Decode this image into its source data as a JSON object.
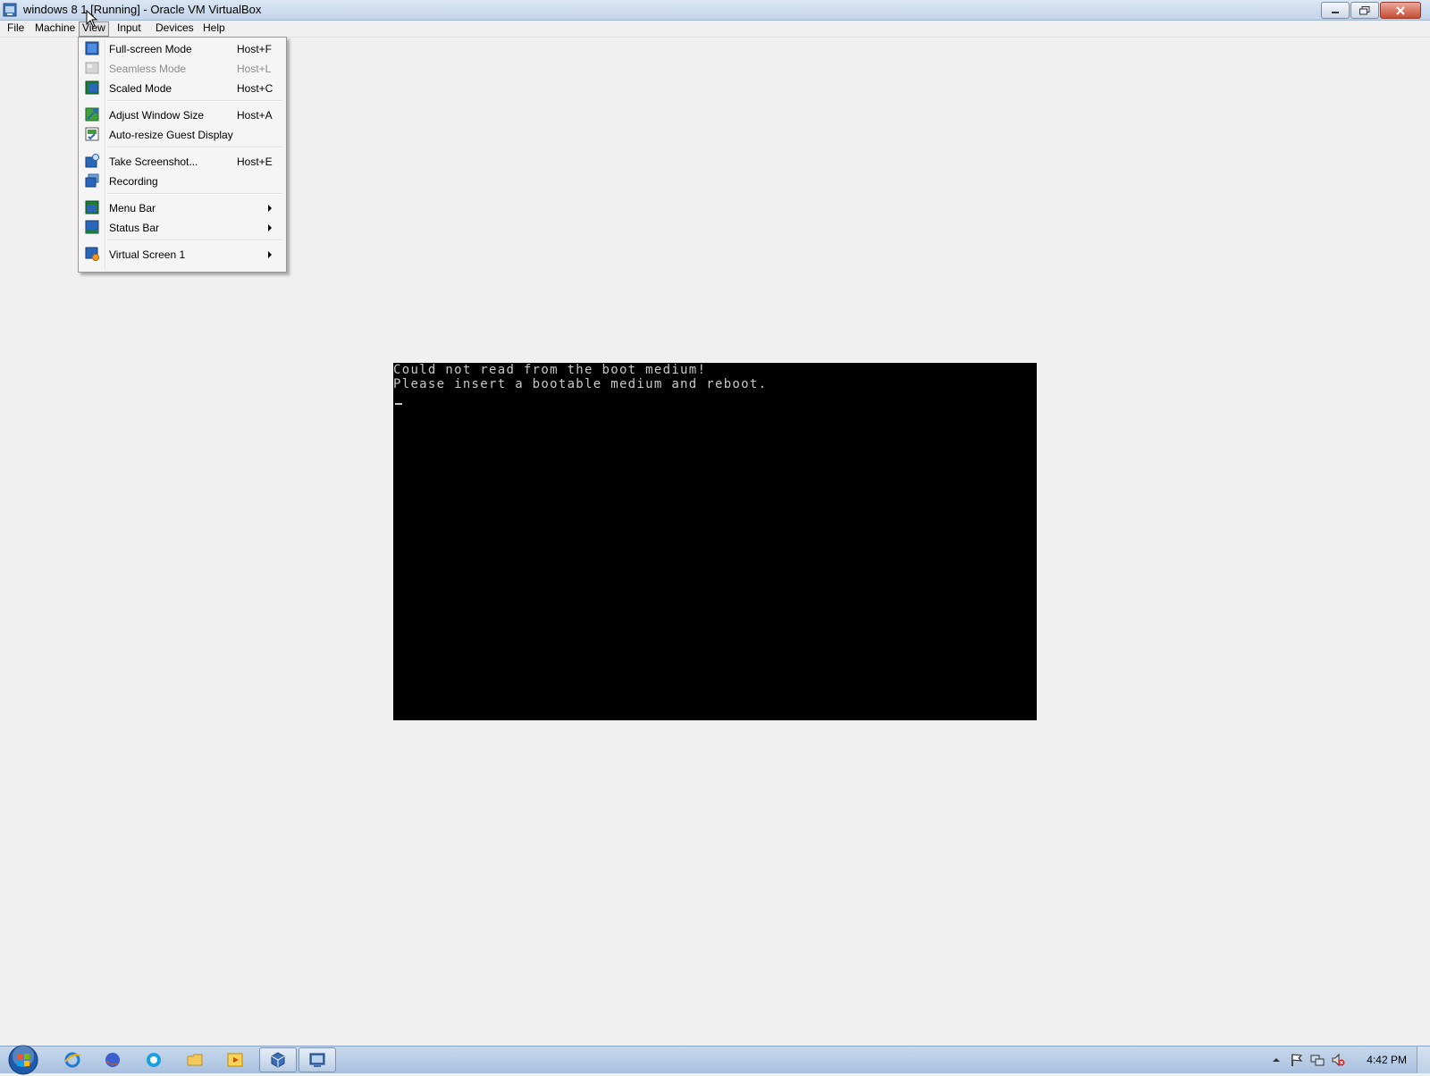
{
  "window": {
    "title": "windows 8 1 [Running] - Oracle VM VirtualBox"
  },
  "menubar": {
    "items": [
      {
        "label": "File"
      },
      {
        "label": "Machine"
      },
      {
        "label": "View"
      },
      {
        "label": "Input"
      },
      {
        "label": "Devices"
      },
      {
        "label": "Help"
      }
    ],
    "active": "View"
  },
  "view_menu": {
    "items": [
      {
        "label": "Full-screen Mode",
        "shortcut": "Host+F",
        "icon": "fullscreen-icon"
      },
      {
        "label": "Seamless Mode",
        "shortcut": "Host+L",
        "icon": "seamless-icon",
        "disabled": true
      },
      {
        "label": "Scaled Mode",
        "shortcut": "Host+C",
        "icon": "scaled-icon"
      },
      {
        "label": "Adjust Window Size",
        "shortcut": "Host+A",
        "icon": "adjust-window-icon"
      },
      {
        "label": "Auto-resize Guest Display",
        "shortcut": "",
        "icon": "auto-resize-icon",
        "checked": true
      },
      {
        "label": "Take Screenshot...",
        "shortcut": "Host+E",
        "icon": "screenshot-icon"
      },
      {
        "label": "Recording",
        "shortcut": "",
        "icon": "recording-icon"
      },
      {
        "label": "Menu Bar",
        "shortcut": "",
        "icon": "menubar-icon",
        "submenu": true
      },
      {
        "label": "Status Bar",
        "shortcut": "",
        "icon": "statusbar-icon",
        "submenu": true
      },
      {
        "label": "Virtual Screen 1",
        "shortcut": "",
        "icon": "virtual-screen-icon",
        "submenu": true
      }
    ]
  },
  "vm_screen": {
    "line1": "Could not read from the boot medium!",
    "line2": "Please insert a bootable medium and reboot."
  },
  "taskbar": {
    "pinned": [
      "start-orb-icon",
      "internet-explorer-icon",
      "firefox-icon",
      "skype-icon",
      "file-explorer-icon",
      "media-player-icon",
      "virtualbox-manager-icon",
      "virtualbox-vm-icon"
    ],
    "clock": "4:42 PM"
  }
}
